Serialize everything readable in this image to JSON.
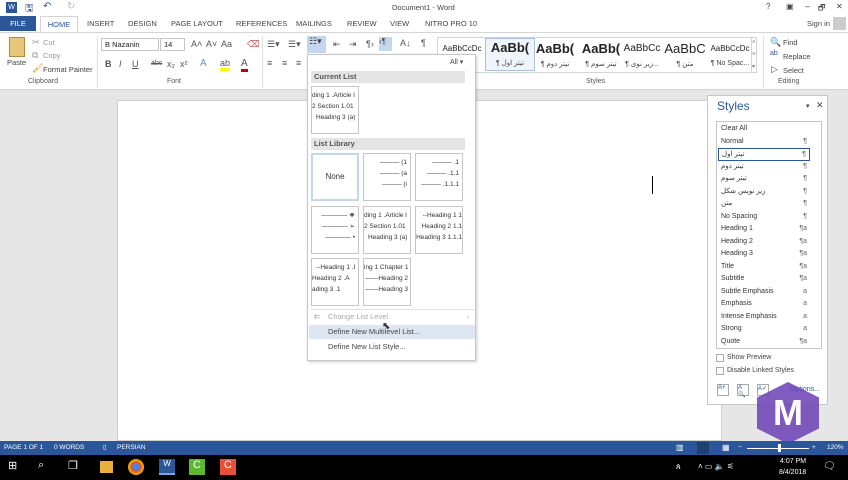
{
  "title": "Document1 - Word",
  "window_controls": {
    "help": "?",
    "minimize": "–",
    "restore": "🗗",
    "close": "✕"
  },
  "sign_in": "Sign in",
  "tabs": {
    "file": "FILE",
    "items": [
      "HOME",
      "INSERT",
      "DESIGN",
      "PAGE LAYOUT",
      "REFERENCES",
      "MAILINGS",
      "REVIEW",
      "VIEW",
      "NITRO PRO 10"
    ]
  },
  "clipboard": {
    "paste": "Paste",
    "cut": "Cut",
    "copy": "Copy",
    "format_painter": "Format Painter",
    "group": "Clipboard"
  },
  "font": {
    "name": "B Nazanin",
    "size": "14",
    "group": "Font",
    "bold": "B",
    "italic": "I",
    "underline": "U",
    "strike": "abc",
    "sub": "x₂",
    "sup": "x²",
    "case": "Aa"
  },
  "styles_gallery": {
    "group": "Styles",
    "items": [
      {
        "preview": "AaBbCcDc",
        "name": "All"
      },
      {
        "preview": "AaBb(",
        "name": "¶ تیتر اول"
      },
      {
        "preview": "AaBb(",
        "name": "¶ تیتر دوم"
      },
      {
        "preview": "AaBb(",
        "name": "¶ تیتر سوم"
      },
      {
        "preview": "AaBbCc",
        "name": "¶ زیر نوی..."
      },
      {
        "preview": "AaBbC",
        "name": "¶ متن"
      },
      {
        "preview": "AaBbCcDc",
        "name": "¶ No Spac..."
      }
    ]
  },
  "editing": {
    "find": "Find",
    "replace": "Replace",
    "select": "Select",
    "group": "Editing"
  },
  "multilevel_menu": {
    "filter": "All ▾",
    "current_list": "Current List",
    "current": [
      "ding 1 .Article I",
      "2 Section 1.01",
      "Heading 3 (a)"
    ],
    "library": "List Library",
    "none": "None",
    "lists": [
      [
        "——— (1",
        "——— (a",
        "——— (i"
      ],
      [
        "——— .1",
        "——— .1.1",
        "——— .1.1.1"
      ],
      [
        "———— ❖",
        "———— ➢",
        "———— •"
      ],
      [
        "ding 1 .Article I",
        "2 Section 1.01",
        "Heading 3 (a)"
      ],
      [
        "--Heading 1 1",
        "Heading 2 1.1",
        "Heading 3 1.1.1"
      ],
      [
        "--Heading 1 .I",
        "Heading 2 .A",
        "ading 3 .1"
      ],
      [
        "ing 1 Chapter 1",
        "——Heading 2",
        "——Heading 3"
      ]
    ],
    "change_level": "Change List Level",
    "define_multilevel": "Define New Multilevel List...",
    "define_style": "Define New List Style..."
  },
  "styles_pane": {
    "title": "Styles",
    "items": [
      {
        "name": "Clear All",
        "mark": ""
      },
      {
        "name": "Normal",
        "mark": "¶"
      },
      {
        "name": "تیتر اول",
        "mark": "¶"
      },
      {
        "name": "تیتر دوم",
        "mark": "¶"
      },
      {
        "name": "تیتر سوم",
        "mark": "¶"
      },
      {
        "name": "زیر نویس شکل",
        "mark": "¶"
      },
      {
        "name": "متن",
        "mark": "¶"
      },
      {
        "name": "No Spacing",
        "mark": "¶"
      },
      {
        "name": "Heading 1",
        "mark": "¶a"
      },
      {
        "name": "Heading 2",
        "mark": "¶a"
      },
      {
        "name": "Heading 3",
        "mark": "¶a"
      },
      {
        "name": "Title",
        "mark": "¶a"
      },
      {
        "name": "Subtitle",
        "mark": "¶a"
      },
      {
        "name": "Subtle Emphasis",
        "mark": "a"
      },
      {
        "name": "Emphasis",
        "mark": "a"
      },
      {
        "name": "Intense Emphasis",
        "mark": "a"
      },
      {
        "name": "Strong",
        "mark": "a"
      },
      {
        "name": "Quote",
        "mark": "¶a"
      }
    ],
    "show_preview": "Show Preview",
    "disable_linked": "Disable Linked Styles",
    "options": "Options..."
  },
  "status": {
    "page": "PAGE 1 OF 1",
    "words": "0 WORDS",
    "language": "PERSIAN",
    "zoom": "120%",
    "zoom_level_percent": 120
  },
  "taskbar": {
    "time": "4:07 PM",
    "date": "8/4/2018"
  },
  "colors": {
    "accent": "#2b579a",
    "selected_style_border": "#2b579a",
    "watermark": "#6a3fb5"
  }
}
